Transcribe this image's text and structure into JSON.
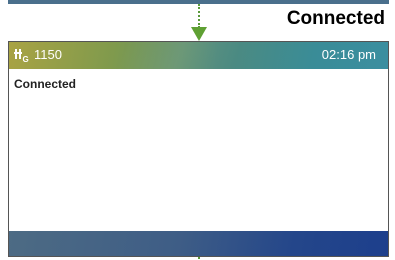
{
  "caption": "Connected",
  "status_bar": {
    "line_icon": "phone-line-icon",
    "extension": "1150",
    "time": "02:16 pm"
  },
  "call": {
    "status": "Connected"
  },
  "colors": {
    "connector": "#5fa033",
    "status_bar_start": "#a9a344",
    "status_bar_end": "#3b8ea0",
    "bottom_bar": "#1d3f8c"
  }
}
